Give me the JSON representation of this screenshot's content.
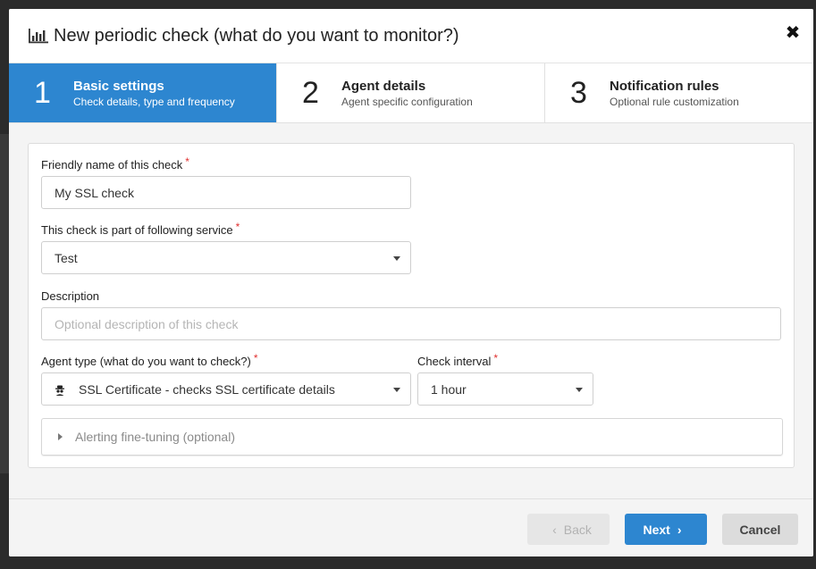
{
  "dialog": {
    "title": "New periodic check (what do you want to monitor?)",
    "close_glyph": "✖"
  },
  "steps": [
    {
      "number": "1",
      "title": "Basic settings",
      "subtitle": "Check details, type and frequency",
      "active": true
    },
    {
      "number": "2",
      "title": "Agent details",
      "subtitle": "Agent specific configuration",
      "active": false
    },
    {
      "number": "3",
      "title": "Notification rules",
      "subtitle": "Optional rule customization",
      "active": false
    }
  ],
  "form": {
    "friendly_name": {
      "label": "Friendly name of this check",
      "required_mark": "*",
      "value": "My SSL check"
    },
    "service": {
      "label": "This check is part of following service",
      "required_mark": "*",
      "value": "Test"
    },
    "description": {
      "label": "Description",
      "placeholder": "Optional description of this check"
    },
    "agent_type": {
      "label": "Agent type (what do you want to check?)",
      "required_mark": "*",
      "value": "SSL Certificate - checks SSL certificate details",
      "icon": "spy-icon"
    },
    "interval": {
      "label": "Check interval",
      "required_mark": "*",
      "value": "1 hour"
    },
    "alerting": {
      "label": "Alerting fine-tuning (optional)"
    }
  },
  "footer": {
    "back_label": "Back",
    "next_label": "Next",
    "cancel_label": "Cancel"
  },
  "colors": {
    "primary": "#2d86d0",
    "required": "#e0302f"
  }
}
